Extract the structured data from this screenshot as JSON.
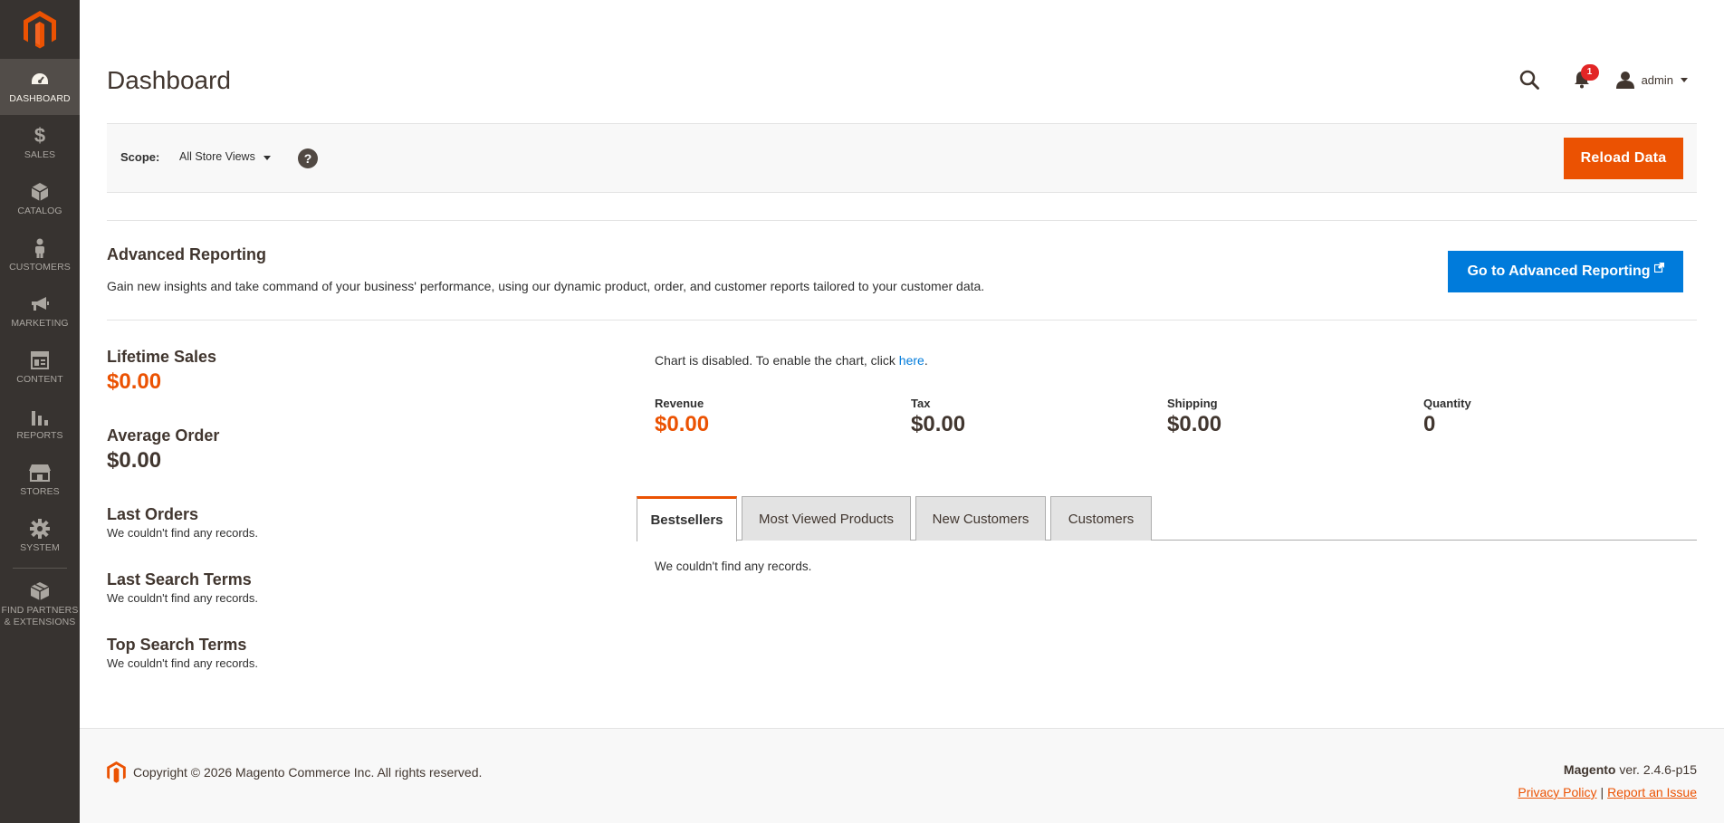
{
  "sidebar": {
    "items": [
      {
        "label": "DASHBOARD",
        "icon": "dashboard-icon"
      },
      {
        "label": "SALES",
        "icon": "dollar-icon"
      },
      {
        "label": "CATALOG",
        "icon": "catalog-icon"
      },
      {
        "label": "CUSTOMERS",
        "icon": "customers-icon"
      },
      {
        "label": "MARKETING",
        "icon": "megaphone-icon"
      },
      {
        "label": "CONTENT",
        "icon": "content-icon"
      },
      {
        "label": "REPORTS",
        "icon": "bar-chart-icon"
      },
      {
        "label": "STORES",
        "icon": "store-icon"
      },
      {
        "label": "SYSTEM",
        "icon": "gear-icon"
      },
      {
        "label_line1": "FIND PARTNERS",
        "label_line2": "& EXTENSIONS",
        "icon": "extensions-icon"
      }
    ]
  },
  "header": {
    "title": "Dashboard",
    "notification_count": "1",
    "user_name": "admin"
  },
  "scope": {
    "label": "Scope:",
    "value": "All Store Views",
    "help": "?",
    "reload_label": "Reload Data"
  },
  "advanced_reporting": {
    "title": "Advanced Reporting",
    "description": "Gain new insights and take command of your business' performance, using our dynamic product, order, and customer reports tailored to your customer data.",
    "button_label": "Go to Advanced Reporting"
  },
  "stats": {
    "lifetime_sales_label": "Lifetime Sales",
    "lifetime_sales_value": "$0.00",
    "average_order_label": "Average Order",
    "average_order_value": "$0.00"
  },
  "blocks": {
    "last_orders_title": "Last Orders",
    "last_orders_empty": "We couldn't find any records.",
    "last_search_title": "Last Search Terms",
    "last_search_empty": "We couldn't find any records.",
    "top_search_title": "Top Search Terms",
    "top_search_empty": "We couldn't find any records."
  },
  "chart": {
    "message": "Chart is disabled. To enable the chart, click ",
    "link": "here",
    "period": "."
  },
  "totals": [
    {
      "label": "Revenue",
      "value": "$0.00"
    },
    {
      "label": "Tax",
      "value": "$0.00"
    },
    {
      "label": "Shipping",
      "value": "$0.00"
    },
    {
      "label": "Quantity",
      "value": "0"
    }
  ],
  "tabs": [
    {
      "label": "Bestsellers",
      "active": true
    },
    {
      "label": "Most Viewed Products",
      "active": false
    },
    {
      "label": "New Customers",
      "active": false
    },
    {
      "label": "Customers",
      "active": false
    }
  ],
  "tab_content": {
    "empty": "We couldn't find any records."
  },
  "footer": {
    "copyright": "Copyright © 2026 Magento Commerce Inc. All rights reserved.",
    "brand": "Magento",
    "version": " ver. 2.4.6-p15",
    "privacy": "Privacy Policy",
    "separator": "|",
    "report": "Report an Issue"
  },
  "colors": {
    "sidebar_bg": "#373330",
    "accent_orange": "#eb5202",
    "link_blue": "#007bdb"
  }
}
